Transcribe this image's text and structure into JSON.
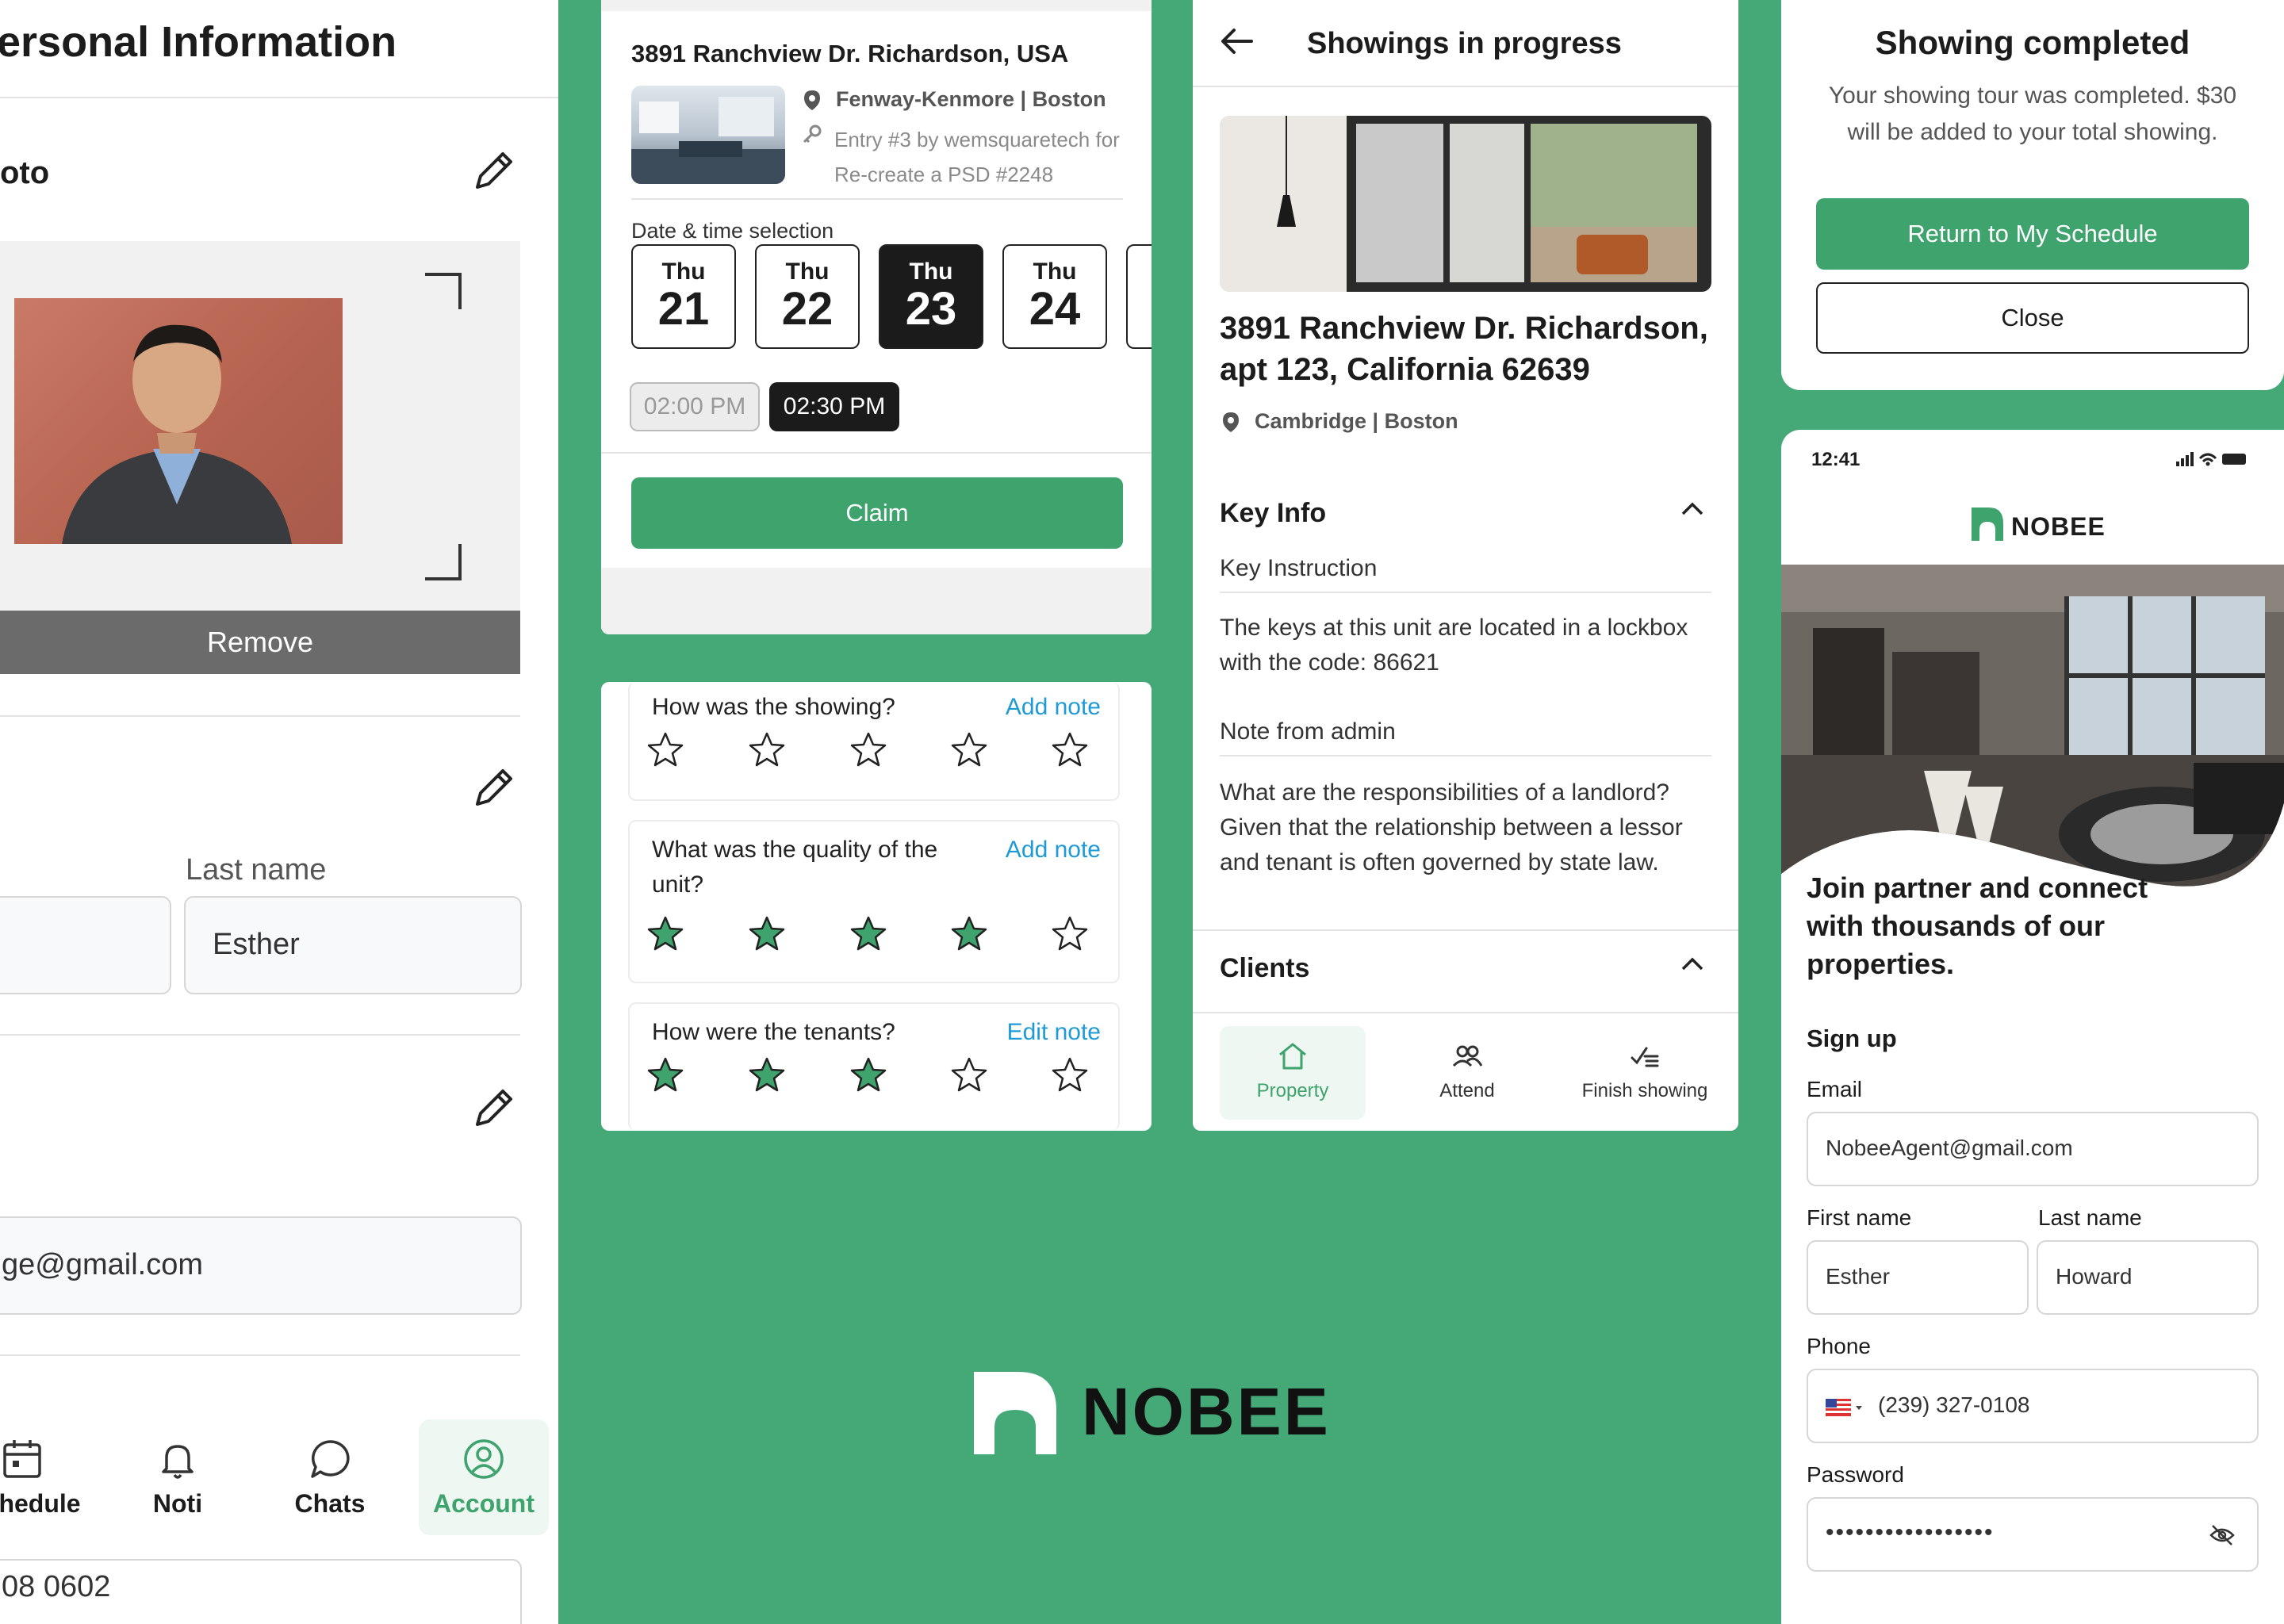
{
  "colors": {
    "brand_green": "#3ea36c",
    "background_green": "#45a877",
    "link_blue": "#1e9bd7",
    "star_fill": "#3ea36c"
  },
  "personal": {
    "title": "ersonal Information",
    "photo_label": "oto",
    "remove_label": "Remove",
    "last_name_label": "Last name",
    "last_name_value": "Esther",
    "email_value": "ge@gmail.com",
    "phone_value": "08 0602",
    "nav": [
      {
        "label": "hedule",
        "icon": "calendar-icon"
      },
      {
        "label": "Noti",
        "icon": "bell-icon"
      },
      {
        "label": "Chats",
        "icon": "chat-icon"
      },
      {
        "label": "Account",
        "icon": "account-icon"
      }
    ]
  },
  "claim": {
    "address": "3891 Ranchview Dr. Richardson, USA",
    "location": "Fenway-Kenmore | Boston",
    "entry_note": "Entry #3 by wemsquaretech for Re-create a PSD #2248",
    "date_section_label": "Date & time selection",
    "dates": [
      {
        "dow": "Thu",
        "day": "21"
      },
      {
        "dow": "Thu",
        "day": "22"
      },
      {
        "dow": "Thu",
        "day": "23"
      },
      {
        "dow": "Thu",
        "day": "24"
      }
    ],
    "selected_date_index": 2,
    "times": [
      "02:00 PM",
      "02:30 PM"
    ],
    "claim_label": "Claim"
  },
  "ratings": {
    "items": [
      {
        "question": "How was the showing?",
        "link": "Add note",
        "stars": 0
      },
      {
        "question": "What was the quality of the unit?",
        "link": "Add note",
        "stars": 4
      },
      {
        "question": "How were the tenants?",
        "link": "Edit note",
        "stars": 3
      }
    ],
    "max_stars": 5
  },
  "showing": {
    "title": "Showings in progress",
    "address": "3891 Ranchview Dr. Richardson, apt 123, California 62639",
    "location": "Cambridge | Boston",
    "key_info_title": "Key Info",
    "key_instruction_label": "Key Instruction",
    "key_instruction_text": "The keys at this unit are located in a lockbox with the code: 86621",
    "note_label": "Note from admin",
    "note_text": "What are the responsibilities of a landlord? Given that the relationship between a lessor and tenant is often governed by state law.",
    "clients_title": "Clients",
    "tabs": [
      {
        "label": "Property",
        "icon": "house-icon"
      },
      {
        "label": "Attend",
        "icon": "people-icon"
      },
      {
        "label": "Finish showing",
        "icon": "checklist-icon"
      }
    ]
  },
  "completed": {
    "title": "Showing completed",
    "message": "Your showing tour was completed. $30 will be added to your total showing.",
    "primary_label": "Return to My Schedule",
    "secondary_label": "Close"
  },
  "signup": {
    "status_time": "12:41",
    "brand": "NOBEE",
    "tagline": "Join partner and connect with thousands of our properties.",
    "section_title": "Sign up",
    "email_label": "Email",
    "email_value": "NobeeAgent@gmail.com",
    "first_name_label": "First name",
    "first_name_value": "Esther",
    "last_name_label": "Last name",
    "last_name_value": "Howard",
    "phone_label": "Phone",
    "phone_value": "(239) 327-0108",
    "password_label": "Password",
    "password_value": "•••••••••••••••••"
  },
  "brand_logo": {
    "name": "NOBEE"
  }
}
